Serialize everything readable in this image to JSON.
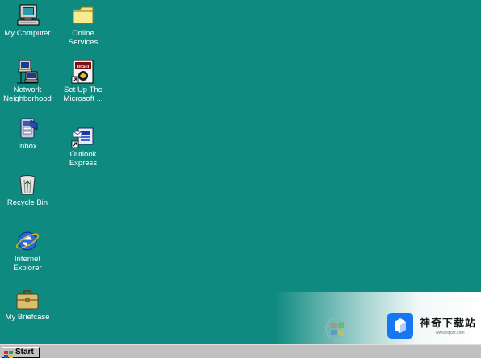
{
  "desktop": {
    "background_color": "#0f8a80",
    "icons": {
      "my_computer": {
        "label": "My Computer",
        "icon": "computer-icon"
      },
      "online_services": {
        "label": "Online\nServices",
        "icon": "folder-icon"
      },
      "network": {
        "label": "Network\nNeighborhood",
        "icon": "network-icon"
      },
      "msn": {
        "label": "Set Up The\nMicrosoft ...",
        "icon": "msn-icon"
      },
      "inbox": {
        "label": "Inbox",
        "icon": "inbox-icon"
      },
      "outlook": {
        "label": "Outlook\nExpress",
        "icon": "outlook-express-icon"
      },
      "recycle_bin": {
        "label": "Recycle Bin",
        "icon": "recycle-bin-icon"
      },
      "internet_explorer": {
        "label": "Internet\nExplorer",
        "icon": "internet-explorer-icon"
      },
      "briefcase": {
        "label": "My Briefcase",
        "icon": "briefcase-icon"
      }
    }
  },
  "watermark": {
    "title": "神奇下载站",
    "url": "www.sqxzz.com",
    "brand_color": "#1677f0"
  },
  "taskbar": {
    "start_label": "Start",
    "background_color": "#c0c0c0"
  }
}
